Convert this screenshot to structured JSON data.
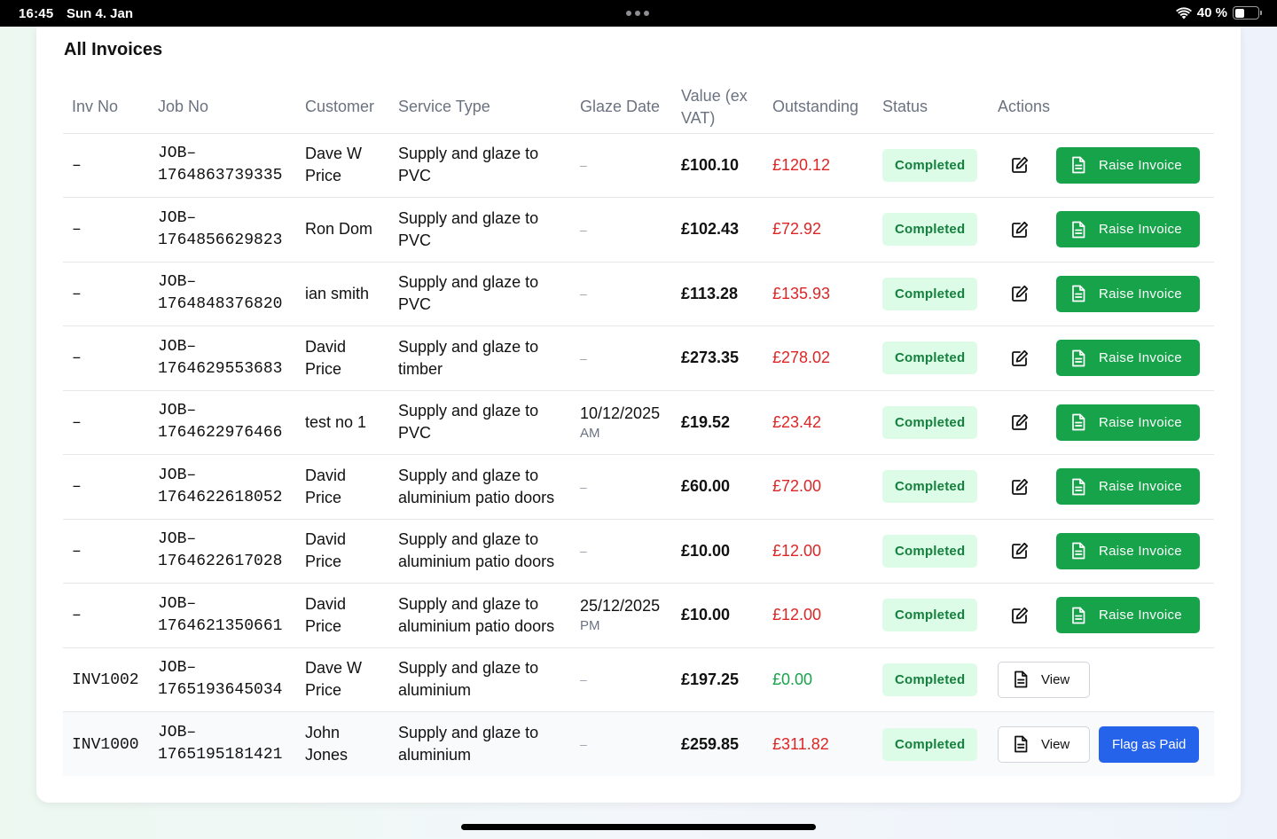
{
  "status_bar": {
    "time": "16:45",
    "date": "Sun 4. Jan",
    "battery": "40 %"
  },
  "page": {
    "title": "All Invoices"
  },
  "table": {
    "headers": [
      "Inv No",
      "Job No",
      "Customer",
      "Service Type",
      "Glaze Date",
      "Value (ex VAT)",
      "Outstanding",
      "Status",
      "Actions"
    ],
    "rows": [
      {
        "inv": "–",
        "job": "JOB–\n1764863739335",
        "customer": "Dave W Price",
        "service": "Supply and glaze to PVC",
        "glaze_date": "–",
        "glaze_ampm": "",
        "value": "£100.10",
        "outstanding": "£120.12",
        "outstanding_color": "red",
        "status": "Completed",
        "action": "raise"
      },
      {
        "inv": "–",
        "job": "JOB–\n1764856629823",
        "customer": "Ron Dom",
        "service": "Supply and glaze to PVC",
        "glaze_date": "–",
        "glaze_ampm": "",
        "value": "£102.43",
        "outstanding": "£72.92",
        "outstanding_color": "red",
        "status": "Completed",
        "action": "raise"
      },
      {
        "inv": "–",
        "job": "JOB–\n1764848376820",
        "customer": "ian smith",
        "service": "Supply and glaze to PVC",
        "glaze_date": "–",
        "glaze_ampm": "",
        "value": "£113.28",
        "outstanding": "£135.93",
        "outstanding_color": "red",
        "status": "Completed",
        "action": "raise"
      },
      {
        "inv": "–",
        "job": "JOB–\n1764629553683",
        "customer": "David Price",
        "service": "Supply and glaze to timber",
        "glaze_date": "–",
        "glaze_ampm": "",
        "value": "£273.35",
        "outstanding": "£278.02",
        "outstanding_color": "red",
        "status": "Completed",
        "action": "raise"
      },
      {
        "inv": "–",
        "job": "JOB–\n1764622976466",
        "customer": "test no 1",
        "service": "Supply and glaze to PVC",
        "glaze_date": "10/12/2025",
        "glaze_ampm": "AM",
        "value": "£19.52",
        "outstanding": "£23.42",
        "outstanding_color": "red",
        "status": "Completed",
        "action": "raise"
      },
      {
        "inv": "–",
        "job": "JOB–\n1764622618052",
        "customer": "David Price",
        "service": "Supply and glaze to aluminium patio doors",
        "glaze_date": "–",
        "glaze_ampm": "",
        "value": "£60.00",
        "outstanding": "£72.00",
        "outstanding_color": "red",
        "status": "Completed",
        "action": "raise"
      },
      {
        "inv": "–",
        "job": "JOB–\n1764622617028",
        "customer": "David Price",
        "service": "Supply and glaze to aluminium patio doors",
        "glaze_date": "–",
        "glaze_ampm": "",
        "value": "£10.00",
        "outstanding": "£12.00",
        "outstanding_color": "red",
        "status": "Completed",
        "action": "raise"
      },
      {
        "inv": "–",
        "job": "JOB–\n1764621350661",
        "customer": "David Price",
        "service": "Supply and glaze to aluminium patio doors",
        "glaze_date": "25/12/2025",
        "glaze_ampm": "PM",
        "value": "£10.00",
        "outstanding": "£12.00",
        "outstanding_color": "red",
        "status": "Completed",
        "action": "raise"
      },
      {
        "inv": "INV1002",
        "job": "JOB–\n1765193645034",
        "customer": "Dave W Price",
        "service": "Supply and glaze to aluminium",
        "glaze_date": "–",
        "glaze_ampm": "",
        "value": "£197.25",
        "outstanding": "£0.00",
        "outstanding_color": "green",
        "status": "Completed",
        "action": "view"
      },
      {
        "inv": "INV1000",
        "job": "JOB–\n1765195181421",
        "customer": "John Jones",
        "service": "Supply and glaze to aluminium",
        "glaze_date": "–",
        "glaze_ampm": "",
        "value": "£259.85",
        "outstanding": "£311.82",
        "outstanding_color": "red",
        "status": "Completed",
        "action": "view_paid"
      }
    ]
  },
  "actions": {
    "raise_label": "Raise Invoice",
    "view_label": "View",
    "flag_paid_label": "Flag as Paid"
  },
  "colors": {
    "green_button": "#16a34a",
    "blue_button": "#2563eb",
    "outstanding_red": "#dc2626",
    "outstanding_green": "#16a34a",
    "badge_bg": "#dcfce7",
    "badge_text": "#15803d"
  }
}
